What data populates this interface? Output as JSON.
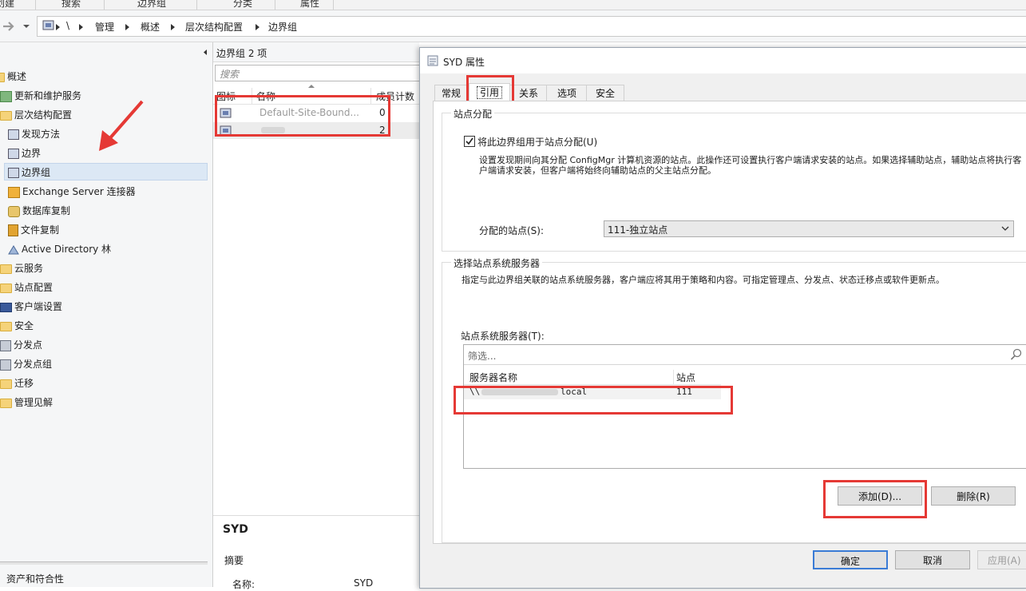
{
  "ribbon": {
    "items": [
      "创建",
      "搜索",
      "边界组",
      "分类",
      "属性"
    ]
  },
  "address_bar": {
    "crumbs": [
      "\\",
      "管理",
      "概述",
      "层次结构配置",
      "边界组"
    ]
  },
  "nav": {
    "items": [
      "概述",
      "更新和维护服务",
      "层次结构配置",
      "发现方法",
      "边界",
      "边界组",
      "Exchange Server 连接器",
      "数据库复制",
      "文件复制",
      "Active Directory 林",
      "云服务",
      "站点配置",
      "客户端设置",
      "安全",
      "分发点",
      "分发点组",
      "迁移",
      "管理见解"
    ],
    "bottom_section": "资产和符合性"
  },
  "list": {
    "header": "边界组 2 项",
    "search_placeholder": "搜索",
    "columns": [
      "图标",
      "名称",
      "成员计数"
    ],
    "rows": [
      {
        "name": "Default-Site-Bound...",
        "count": "0"
      },
      {
        "name": "",
        "count": "2"
      }
    ],
    "detail_title": "SYD",
    "detail_section": "摘要",
    "detail_label": "名称:",
    "detail_value": "SYD"
  },
  "dialog": {
    "title": "SYD 属性",
    "tabs": [
      "常规",
      "引用",
      "关系",
      "选项",
      "安全"
    ],
    "site_assignment": {
      "title": "站点分配",
      "checkbox_label": "将此边界组用于站点分配(U)",
      "checkbox_checked": true,
      "description": "设置发现期间向其分配 ConfigMgr 计算机资源的站点。此操作还可设置执行客户端请求安装的站点。如果选择辅助站点，辅助站点将执行客户端请求安装，但客户端将始终向辅助站点的父主站点分配。",
      "assigned_site_label": "分配的站点(S):",
      "assigned_site_value": "111-独立站点"
    },
    "site_servers": {
      "title": "选择站点系统服务器",
      "description": "指定与此边界组关联的站点系统服务器，客户端应将其用于策略和内容。可指定管理点、分发点、状态迁移点或软件更新点。",
      "list_label": "站点系统服务器(T):",
      "filter_placeholder": "筛选...",
      "columns": [
        "服务器名称",
        "站点"
      ],
      "rows": [
        {
          "server": "\\\\",
          "server_suffix": "local",
          "site": "111"
        }
      ],
      "add_button": "添加(D)...",
      "remove_button": "删除(R)"
    },
    "buttons": {
      "ok": "确定",
      "cancel": "取消",
      "apply": "应用(A)"
    }
  },
  "colors": {
    "highlight_red": "#e53935",
    "accent_blue": "#3a7bd5",
    "folder_yellow": "#f5d37a"
  }
}
